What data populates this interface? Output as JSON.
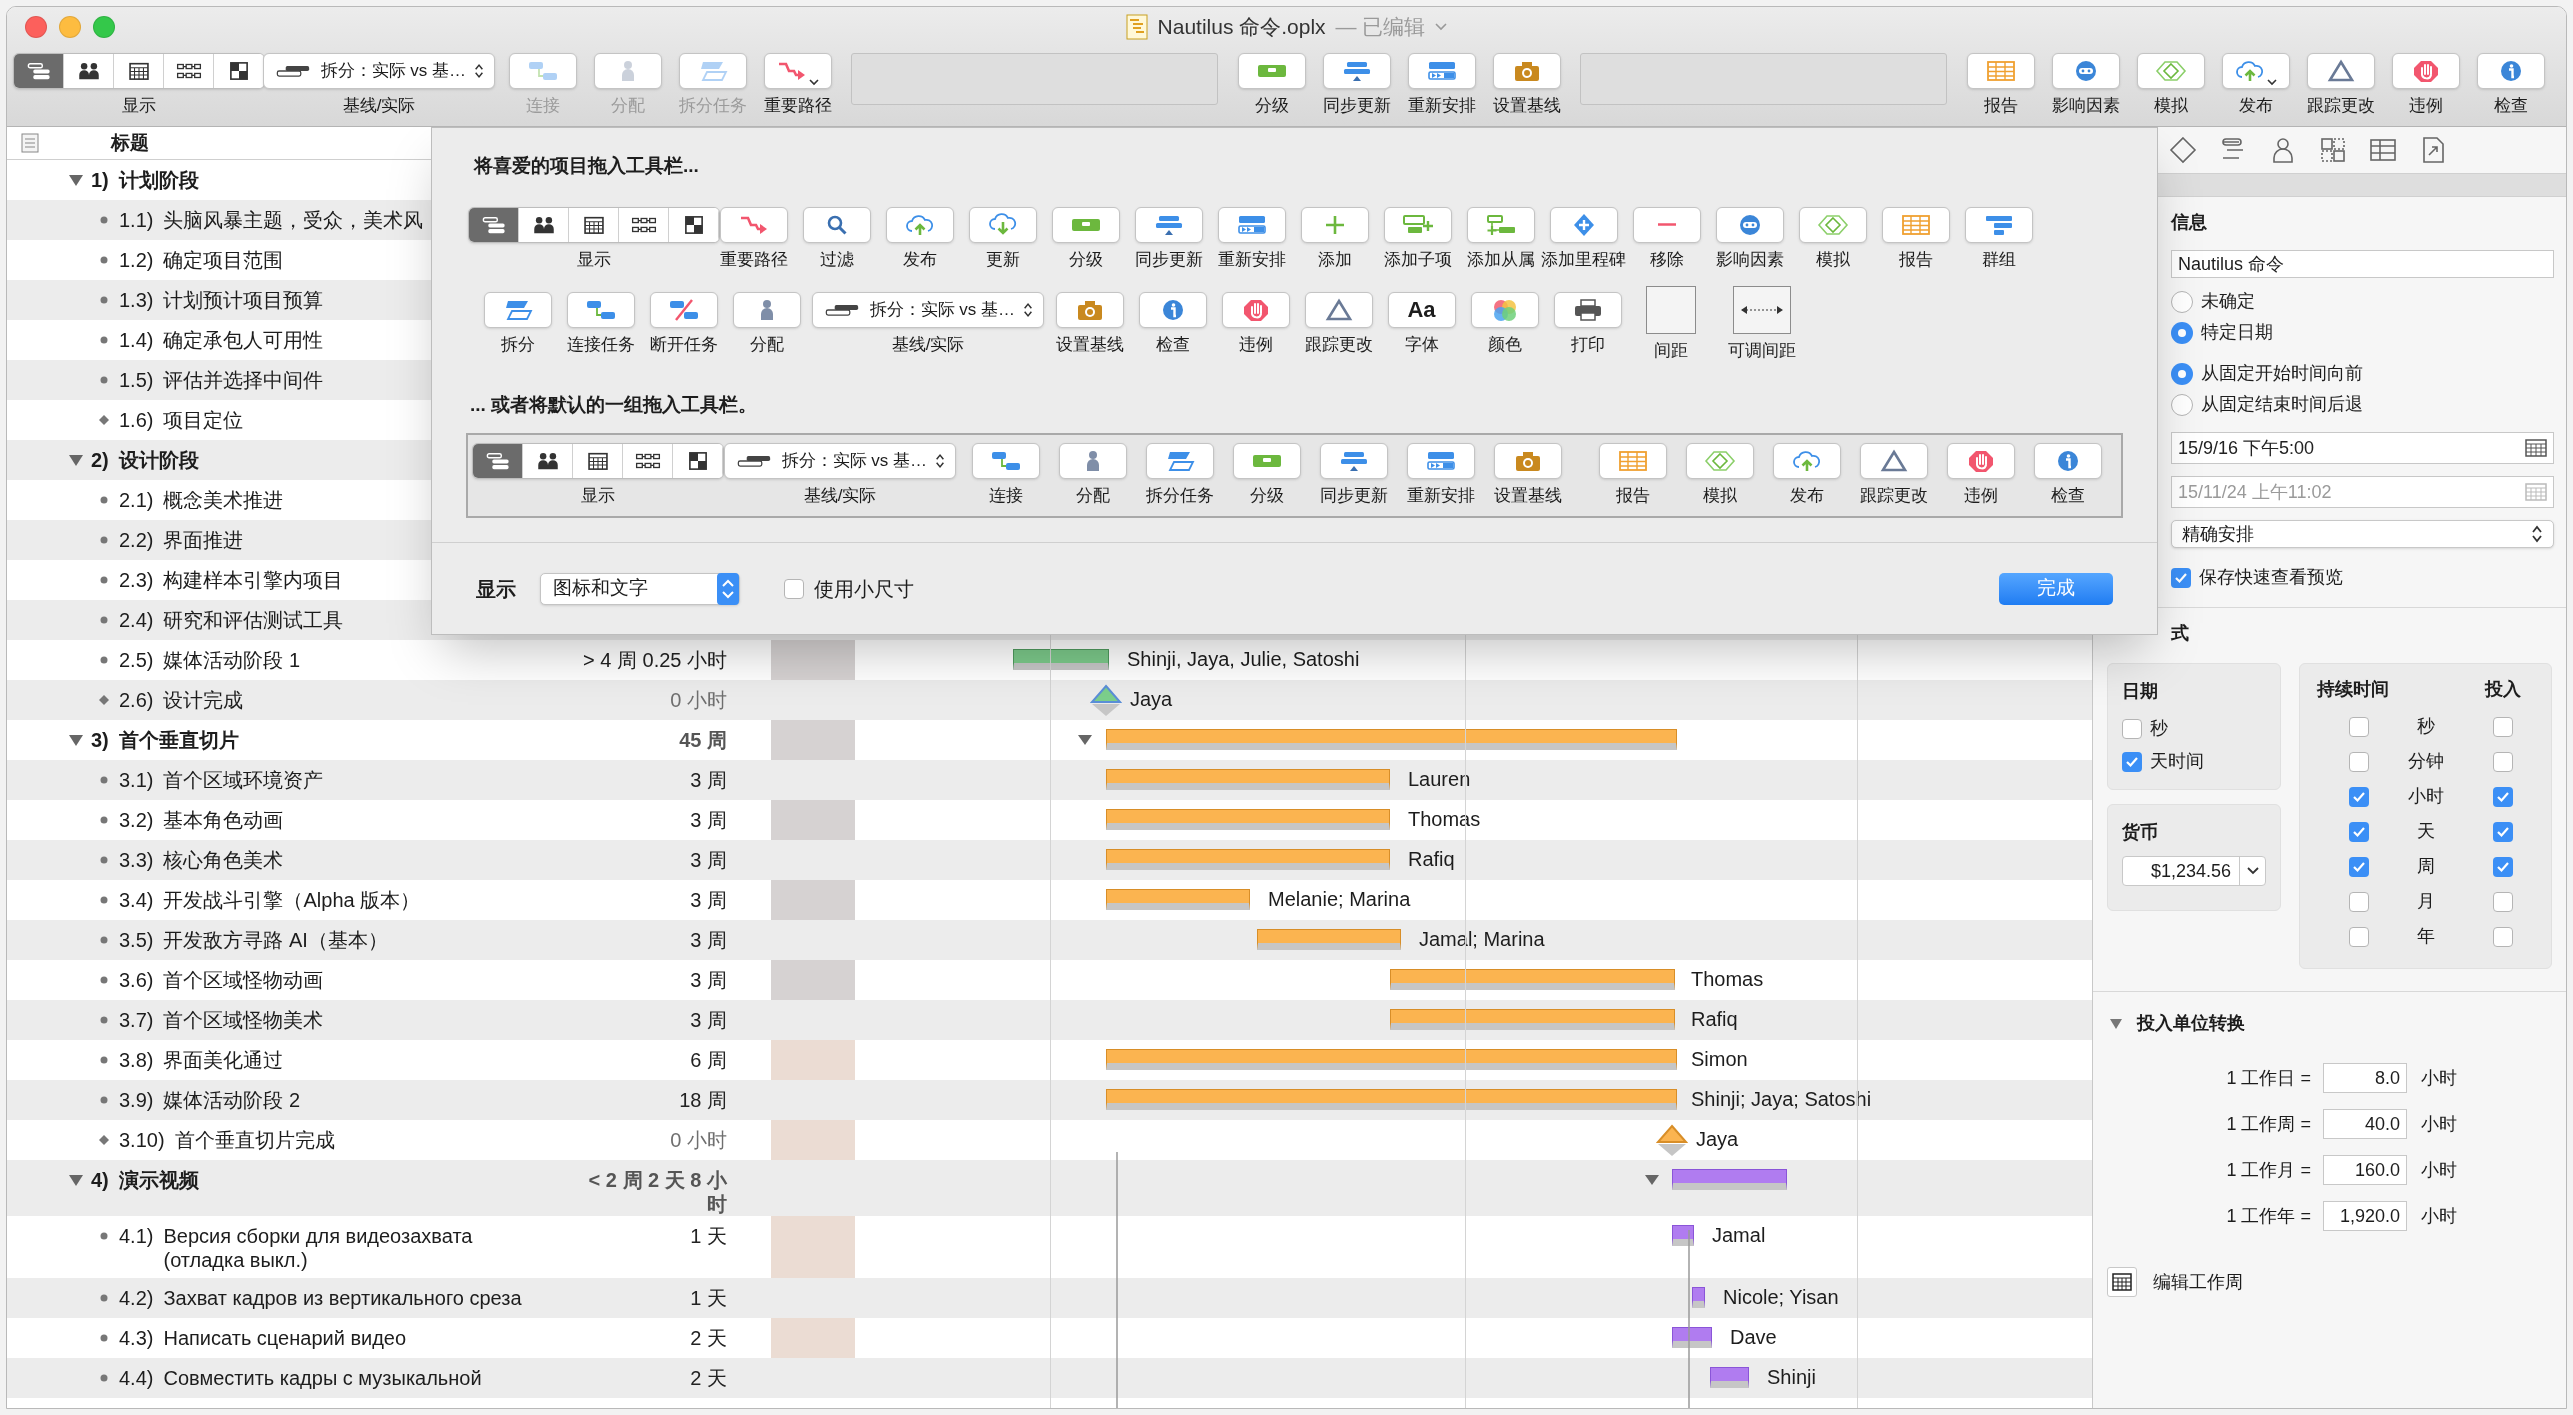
{
  "window": {
    "title": "Nautilus 命令.oplx",
    "edit_status": "— 已编辑"
  },
  "toolbar": {
    "items": [
      {
        "kind": "segmented",
        "label": "显示",
        "segments": [
          {
            "selected": true
          },
          {
            "selected": false
          },
          {
            "selected": false
          },
          {
            "selected": false
          },
          {
            "selected": false
          }
        ]
      },
      {
        "kind": "select",
        "label": "基线/实际",
        "value": "拆分：实际 vs 基…"
      },
      {
        "kind": "button",
        "label": "连接",
        "disabled": true,
        "menu": false
      },
      {
        "kind": "button",
        "label": "分配",
        "disabled": true,
        "menu": false
      },
      {
        "kind": "button",
        "label": "拆分任务",
        "disabled": true,
        "menu": false
      },
      {
        "kind": "button",
        "label": "重要路径",
        "disabled": false,
        "menu": true
      },
      {
        "kind": "spacer"
      },
      {
        "kind": "button",
        "label": "分级",
        "disabled": false,
        "menu": false
      },
      {
        "kind": "button",
        "label": "同步更新",
        "disabled": false,
        "menu": false
      },
      {
        "kind": "button",
        "label": "重新安排",
        "disabled": false,
        "menu": false
      },
      {
        "kind": "button",
        "label": "设置基线",
        "disabled": false,
        "menu": false
      },
      {
        "kind": "spacer"
      },
      {
        "kind": "button",
        "label": "报告",
        "disabled": false,
        "menu": false
      },
      {
        "kind": "button",
        "label": "影响因素",
        "disabled": false,
        "menu": false
      },
      {
        "kind": "button",
        "label": "模拟",
        "disabled": false,
        "menu": false
      },
      {
        "kind": "button",
        "label": "发布",
        "disabled": false,
        "menu": true
      },
      {
        "kind": "button",
        "label": "跟踪更改",
        "disabled": false,
        "menu": false
      },
      {
        "kind": "button",
        "label": "违例",
        "disabled": false,
        "menu": false
      },
      {
        "kind": "button",
        "label": "检查",
        "disabled": false,
        "menu": false
      }
    ]
  },
  "customize_sheet": {
    "heading": "将喜爱的项目拖入工具栏...",
    "palette_rows": [
      [
        {
          "kind": "segmented",
          "label": "显示",
          "segments": [
            {
              "selected": true
            },
            {
              "selected": false
            },
            {
              "selected": false
            },
            {
              "selected": false
            },
            {
              "selected": false
            }
          ]
        },
        {
          "kind": "button",
          "label": "重要路径"
        },
        {
          "kind": "button",
          "label": "过滤"
        },
        {
          "kind": "button",
          "label": "发布"
        },
        {
          "kind": "button",
          "label": "更新"
        },
        {
          "kind": "button",
          "label": "分级"
        },
        {
          "kind": "button",
          "label": "同步更新"
        },
        {
          "kind": "button",
          "label": "重新安排"
        },
        {
          "kind": "button",
          "label": "添加"
        },
        {
          "kind": "button",
          "label": "添加子项"
        },
        {
          "kind": "button",
          "label": "添加从属"
        },
        {
          "kind": "button",
          "label": "添加里程碑"
        },
        {
          "kind": "button",
          "label": "移除"
        },
        {
          "kind": "button",
          "label": "影响因素"
        },
        {
          "kind": "button",
          "label": "模拟"
        },
        {
          "kind": "button",
          "label": "报告"
        },
        {
          "kind": "button",
          "label": "群组"
        }
      ],
      [
        {
          "kind": "button",
          "label": "拆分"
        },
        {
          "kind": "button",
          "label": "连接任务"
        },
        {
          "kind": "button",
          "label": "断开任务"
        },
        {
          "kind": "button",
          "label": "分配"
        },
        {
          "kind": "select",
          "label": "基线/实际",
          "value": "拆分：实际 vs 基…"
        },
        {
          "kind": "button",
          "label": "设置基线"
        },
        {
          "kind": "button",
          "label": "检查"
        },
        {
          "kind": "button",
          "label": "违例"
        },
        {
          "kind": "button",
          "label": "跟踪更改"
        },
        {
          "kind": "glyph",
          "label": "字体",
          "glyph": "Aa"
        },
        {
          "kind": "button",
          "label": "颜色"
        },
        {
          "kind": "button",
          "label": "打印"
        },
        {
          "kind": "space",
          "label": "间距"
        },
        {
          "kind": "flexspace",
          "label": "可调间距"
        }
      ]
    ],
    "default_heading": "... 或者将默认的一组拖入工具栏。",
    "default_set": [
      {
        "kind": "segmented",
        "label": "显示",
        "segments": [
          {
            "selected": true
          },
          {
            "selected": false
          },
          {
            "selected": false
          },
          {
            "selected": false
          },
          {
            "selected": false
          }
        ]
      },
      {
        "kind": "select",
        "label": "基线/实际",
        "value": "拆分：实际 vs 基…"
      },
      {
        "kind": "button",
        "label": "连接"
      },
      {
        "kind": "button",
        "label": "分配"
      },
      {
        "kind": "button",
        "label": "拆分任务"
      },
      {
        "kind": "button",
        "label": "分级"
      },
      {
        "kind": "button",
        "label": "同步更新"
      },
      {
        "kind": "button",
        "label": "重新安排"
      },
      {
        "kind": "button",
        "label": "设置基线"
      },
      {
        "kind": "button",
        "label": "报告"
      },
      {
        "kind": "button",
        "label": "模拟"
      },
      {
        "kind": "button",
        "label": "发布"
      },
      {
        "kind": "button",
        "label": "跟踪更改"
      },
      {
        "kind": "button",
        "label": "违例"
      },
      {
        "kind": "button",
        "label": "检查"
      }
    ],
    "footer": {
      "show_label": "显示",
      "show_value": "图标和文字",
      "small_size": {
        "label": "使用小尺寸",
        "checked": false
      },
      "done": "完成"
    }
  },
  "outline": {
    "header": "标题",
    "rows": [
      {
        "number": "1)",
        "title": "计划阶段",
        "kind": "group",
        "expanded": true,
        "children": [
          {
            "number": "1.1)",
            "title": "头脑风暴主题，受众，美术风",
            "kind": "task"
          },
          {
            "number": "1.2)",
            "title": "确定项目范围",
            "kind": "task"
          },
          {
            "number": "1.3)",
            "title": "计划预计项目预算",
            "kind": "task"
          },
          {
            "number": "1.4)",
            "title": "确定承包人可用性",
            "kind": "task"
          },
          {
            "number": "1.5)",
            "title": "评估并选择中间件",
            "kind": "task"
          },
          {
            "number": "1.6)",
            "title": "项目定位",
            "kind": "milestone"
          }
        ]
      },
      {
        "number": "2)",
        "title": "设计阶段",
        "kind": "group",
        "expanded": true,
        "children": [
          {
            "number": "2.1)",
            "title": "概念美术推进",
            "kind": "task"
          },
          {
            "number": "2.2)",
            "title": "界面推进",
            "kind": "task"
          },
          {
            "number": "2.3)",
            "title": "构建样本引擎内项目",
            "kind": "task"
          },
          {
            "number": "2.4)",
            "title": "研究和评估测试工具",
            "kind": "task"
          },
          {
            "number": "2.5)",
            "title": "媒体活动阶段 1",
            "kind": "task",
            "duration": "> 4 周 0.25 小时",
            "resources": "Shinji, Jaya, Julie, Satoshi"
          },
          {
            "number": "2.6)",
            "title": "设计完成",
            "kind": "milestone",
            "duration": "0 小时",
            "resources": "Jaya"
          }
        ]
      },
      {
        "number": "3)",
        "title": "首个垂直切片",
        "kind": "group",
        "expanded": true,
        "duration": "45 周",
        "children": [
          {
            "number": "3.1)",
            "title": "首个区域环境资产",
            "kind": "task",
            "duration": "3 周",
            "resources": "Lauren"
          },
          {
            "number": "3.2)",
            "title": "基本角色动画",
            "kind": "task",
            "duration": "3 周",
            "resources": "Thomas"
          },
          {
            "number": "3.3)",
            "title": "核心角色美术",
            "kind": "task",
            "duration": "3 周",
            "resources": "Rafiq"
          },
          {
            "number": "3.4)",
            "title": "开发战斗引擎（Alpha 版本）",
            "kind": "task",
            "duration": "3 周",
            "resources": "Melanie; Marina"
          },
          {
            "number": "3.5)",
            "title": "开发敌方寻路 AI（基本）",
            "kind": "task",
            "duration": "3 周",
            "resources": "Jamal; Marina"
          },
          {
            "number": "3.6)",
            "title": "首个区域怪物动画",
            "kind": "task",
            "duration": "3 周",
            "resources": "Thomas"
          },
          {
            "number": "3.7)",
            "title": "首个区域怪物美术",
            "kind": "task",
            "duration": "3 周",
            "resources": "Rafiq"
          },
          {
            "number": "3.8)",
            "title": "界面美化通过",
            "kind": "task",
            "duration": "6 周",
            "resources": "Simon"
          },
          {
            "number": "3.9)",
            "title": "媒体活动阶段 2",
            "kind": "task",
            "duration": "18 周",
            "resources": "Shinji; Jaya; Satoshi"
          },
          {
            "number": "3.10)",
            "title": "首个垂直切片完成",
            "kind": "milestone",
            "duration": "0 小时",
            "resources": "Jaya"
          }
        ]
      },
      {
        "number": "4)",
        "title": "演示视频",
        "kind": "group",
        "expanded": true,
        "duration": "< 2 周 2 天 8 小时",
        "children": [
          {
            "number": "4.1)",
            "title": "Версия сборки для видеозахвата (отладка выкл.)",
            "kind": "task",
            "duration": "1 天",
            "resources": "Jamal"
          },
          {
            "number": "4.2)",
            "title": "Захват кадров из вертикального среза",
            "kind": "task",
            "duration": "1 天",
            "resources": "Nicole; Yisan"
          },
          {
            "number": "4.3)",
            "title": "Написать сценарий видео",
            "kind": "task",
            "duration": "2 天",
            "resources": "Dave"
          },
          {
            "number": "4.4)",
            "title": "Совместить кадры с музыкальной",
            "kind": "task",
            "duration": "2 天",
            "resources": "Shinji"
          }
        ]
      }
    ]
  },
  "inspector": {
    "section_title": "信息",
    "name_field": "Nautilus 命令",
    "date_mode": [
      {
        "label": "未确定",
        "selected": false
      },
      {
        "label": "特定日期",
        "selected": true
      }
    ],
    "direction": [
      {
        "label": "从固定开始时间向前",
        "selected": true
      },
      {
        "label": "从固定结束时间后退",
        "selected": false
      }
    ],
    "start_date": {
      "value": "15/9/16 下午5:00",
      "disabled": false
    },
    "end_date": {
      "value": "15/11/24 上午11:02",
      "disabled": true
    },
    "schedule_select": "精确安排",
    "quicklook": {
      "label": "保存快速查看预览",
      "checked": true
    },
    "format_title": "式",
    "date_box": {
      "title": "日期",
      "options": [
        {
          "label": "秒",
          "checked": false
        },
        {
          "label": "天时间",
          "checked": true
        }
      ]
    },
    "currency_box": {
      "title": "货币",
      "value": "$1,234.56"
    },
    "units_box": {
      "duration_header": "持续时间",
      "effort_header": "投入",
      "rows": [
        {
          "unit": "秒",
          "duration_checked": false,
          "effort_checked": false
        },
        {
          "unit": "分钟",
          "duration_checked": false,
          "effort_checked": false
        },
        {
          "unit": "小时",
          "duration_checked": true,
          "effort_checked": true
        },
        {
          "unit": "天",
          "duration_checked": true,
          "effort_checked": true
        },
        {
          "unit": "周",
          "duration_checked": true,
          "effort_checked": true
        },
        {
          "unit": "月",
          "duration_checked": false,
          "effort_checked": false
        },
        {
          "unit": "年",
          "duration_checked": false,
          "effort_checked": false
        }
      ]
    },
    "conversion": {
      "title": "投入单位转换",
      "expanded": true,
      "rows": [
        {
          "label": "1 工作日 =",
          "value": "8.0",
          "unit": "小时"
        },
        {
          "label": "1 工作周 =",
          "value": "40.0",
          "unit": "小时"
        },
        {
          "label": "1 工作月 =",
          "value": "160.0",
          "unit": "小时"
        },
        {
          "label": "1 工作年 =",
          "value": "1,920.0",
          "unit": "小时"
        }
      ]
    },
    "edit_workweek": "编辑工作周"
  }
}
